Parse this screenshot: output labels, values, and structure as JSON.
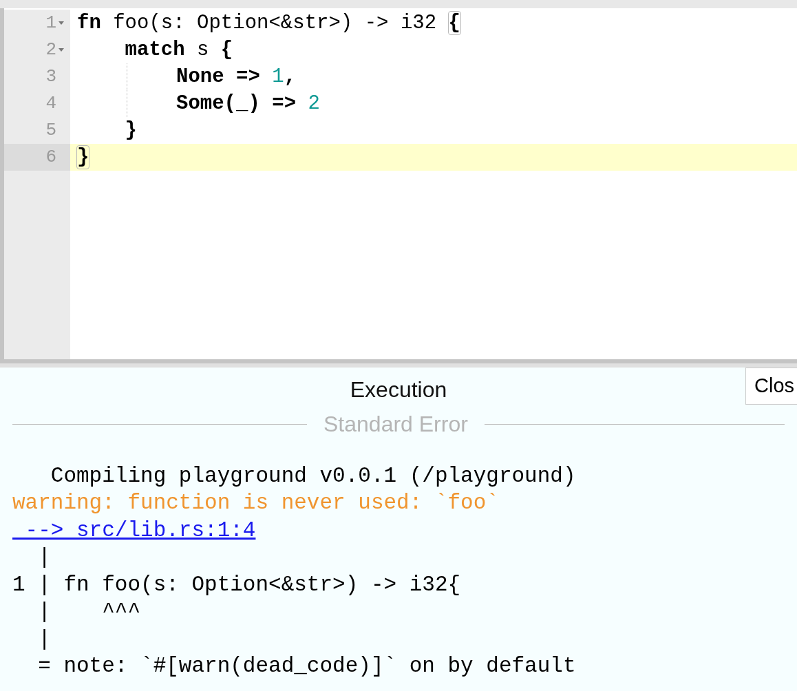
{
  "editor": {
    "lines": [
      {
        "number": "1",
        "foldable": true,
        "active": false,
        "guide": false,
        "tokens": [
          {
            "kind": "keyword",
            "text": "fn"
          },
          {
            "kind": "plain",
            "text": " foo(s: Option<&str>) -> i32 "
          },
          {
            "kind": "bracket",
            "text": "{"
          }
        ]
      },
      {
        "number": "2",
        "foldable": true,
        "active": false,
        "guide": false,
        "tokens": [
          {
            "kind": "keyword",
            "text": "    match"
          },
          {
            "kind": "plain",
            "text": " s "
          },
          {
            "kind": "keyword",
            "text": "{"
          }
        ]
      },
      {
        "number": "3",
        "foldable": false,
        "active": false,
        "guide": true,
        "tokens": [
          {
            "kind": "keyword",
            "text": "None => "
          },
          {
            "kind": "number",
            "text": "1"
          },
          {
            "kind": "keyword",
            "text": ","
          }
        ]
      },
      {
        "number": "4",
        "foldable": false,
        "active": false,
        "guide": true,
        "tokens": [
          {
            "kind": "keyword",
            "text": "Some(_) => "
          },
          {
            "kind": "number",
            "text": "2"
          }
        ]
      },
      {
        "number": "5",
        "foldable": false,
        "active": false,
        "guide": false,
        "tokens": [
          {
            "kind": "keyword",
            "text": "    }"
          }
        ]
      },
      {
        "number": "6",
        "foldable": false,
        "active": true,
        "guide": false,
        "tokens": [
          {
            "kind": "bracket",
            "text": "}"
          }
        ]
      }
    ]
  },
  "output": {
    "title": "Execution",
    "close_button": "Clos",
    "section": "Standard Error",
    "lines": [
      {
        "kind": "plain",
        "text": "   Compiling playground v0.0.1 (/playground)"
      },
      {
        "kind": "warning",
        "text": "warning: function is never used: `foo`"
      },
      {
        "kind": "link",
        "text": " --> src/lib.rs:1:4"
      },
      {
        "kind": "plain",
        "text": "  |"
      },
      {
        "kind": "plain",
        "text": "1 | fn foo(s: Option<&str>) -> i32{"
      },
      {
        "kind": "plain",
        "text": "  |    ^^^"
      },
      {
        "kind": "plain",
        "text": "  |"
      },
      {
        "kind": "plain",
        "text": "  = note: `#[warn(dead_code)]` on by default"
      }
    ]
  }
}
